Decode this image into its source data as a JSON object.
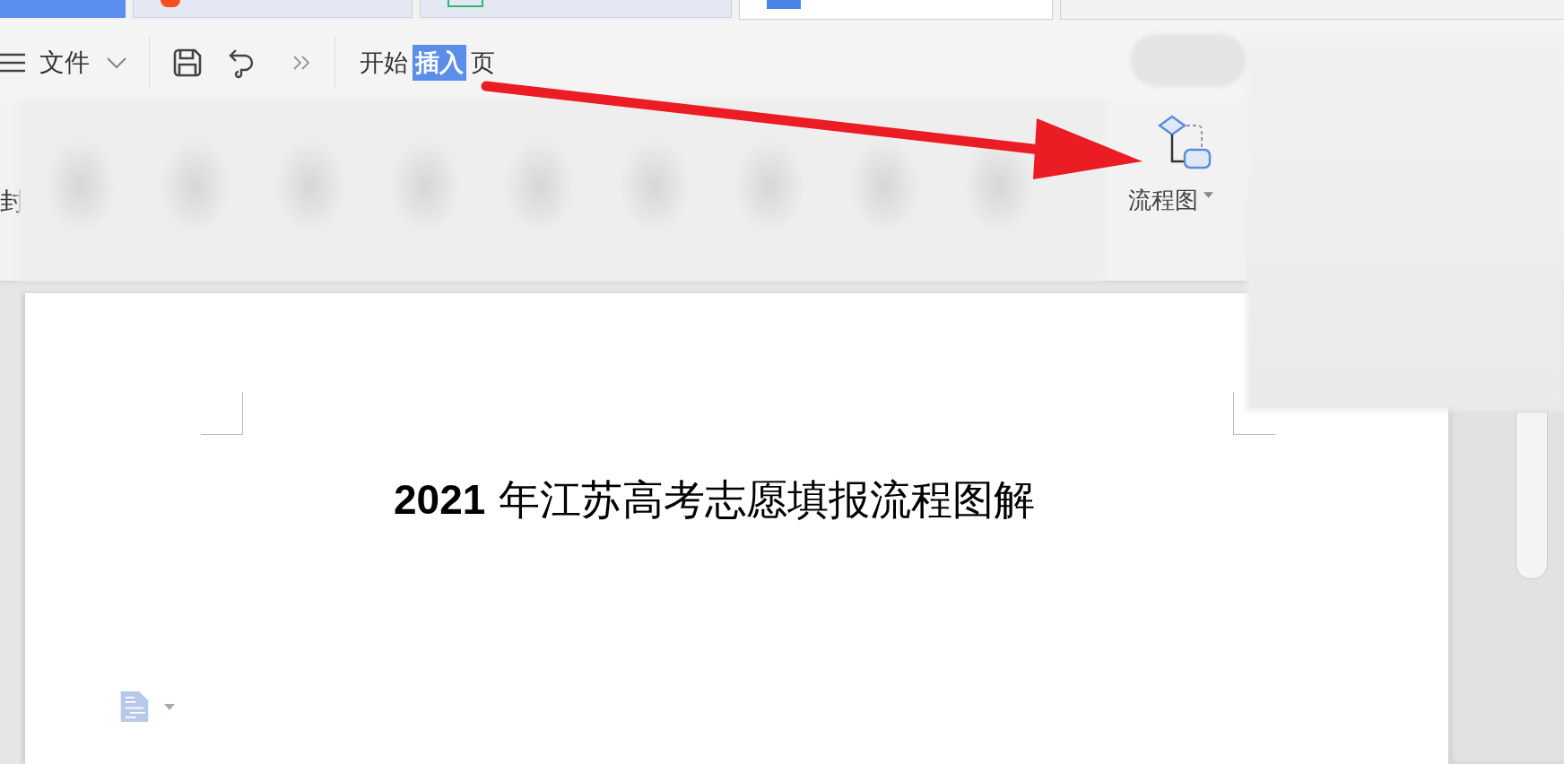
{
  "tabs": [
    {
      "kind": "home",
      "selected": false
    },
    {
      "kind": "orange",
      "selected": false
    },
    {
      "kind": "green",
      "selected": false
    },
    {
      "kind": "blue",
      "selected": true
    }
  ],
  "toolbar": {
    "file_menu": "文件",
    "ribbon_tabs": [
      {
        "label": "开始",
        "selected": false
      },
      {
        "label": "插入",
        "selected": true
      },
      {
        "label": "页",
        "selected": false
      }
    ]
  },
  "ribbon": {
    "cut_label": "封",
    "tools": [
      {
        "label": "流程图",
        "kind": "flowchart"
      }
    ]
  },
  "document": {
    "title": "**2021** 年江苏高考志愿填报流程图解"
  }
}
